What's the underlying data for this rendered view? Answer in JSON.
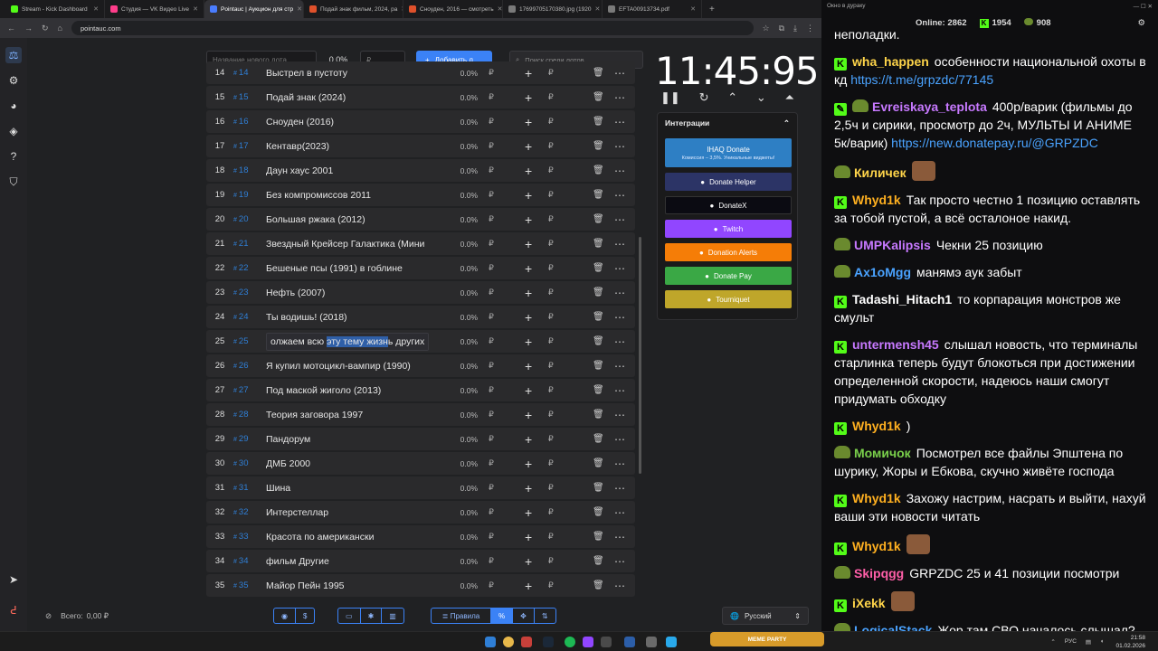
{
  "browser": {
    "tabs": [
      {
        "title": "Stream - Kick Dashboard",
        "color": "#53fc18"
      },
      {
        "title": "Студия — VK Видео Live",
        "color": "#ff3d8b"
      },
      {
        "title": "Pointauc | Аукцион для стр",
        "color": "#4a7dff"
      },
      {
        "title": "Подай знак фильм, 2024, ра",
        "color": "#e0512b"
      },
      {
        "title": "Сноуден, 2016 — смотреть",
        "color": "#e0512b"
      },
      {
        "title": "17699705170380.jpg (1920",
        "color": "#7a7a7a"
      },
      {
        "title": "EFTA00913734.pdf",
        "color": "#7a7a7a"
      }
    ],
    "url": "pointauc.com"
  },
  "toolbar": {
    "lot_placeholder": "Название нового лота",
    "percent": "0.0%",
    "price_placeholder": "₽",
    "add_label": "Добавить л",
    "search_placeholder": "Поиск среди лотов..."
  },
  "lots": [
    {
      "num": "14",
      "id": "14",
      "name": "Выстрел в пустоту",
      "pct": "0.0%"
    },
    {
      "num": "15",
      "id": "15",
      "name": "Подай знак (2024)",
      "pct": "0.0%"
    },
    {
      "num": "16",
      "id": "16",
      "name": "Сноуден (2016)",
      "pct": "0.0%"
    },
    {
      "num": "17",
      "id": "17",
      "name": "Кентавр(2023)",
      "pct": "0.0%"
    },
    {
      "num": "18",
      "id": "18",
      "name": "Даун хаус 2001",
      "pct": "0.0%"
    },
    {
      "num": "19",
      "id": "19",
      "name": "Без компромиссов 2011",
      "pct": "0.0%"
    },
    {
      "num": "20",
      "id": "20",
      "name": "Большая ржака (2012)",
      "pct": "0.0%"
    },
    {
      "num": "21",
      "id": "21",
      "name": "Звездный Крейсер Галактика (Мини",
      "pct": "0.0%"
    },
    {
      "num": "22",
      "id": "22",
      "name": "Бешеные псы (1991) в гоблине",
      "pct": "0.0%"
    },
    {
      "num": "23",
      "id": "23",
      "name": "Нефть (2007)",
      "pct": "0.0%"
    },
    {
      "num": "24",
      "id": "24",
      "name": "Ты водишь! (2018)",
      "pct": "0.0%"
    },
    {
      "num": "25",
      "id": "25",
      "name": "",
      "name_a": "олжаем всю ",
      "name_hl": "эту тему жизн",
      "name_b": "ь других",
      "pct": "0.0%"
    },
    {
      "num": "26",
      "id": "26",
      "name": "Я купил мотоцикл-вампир (1990)",
      "pct": "0.0%"
    },
    {
      "num": "27",
      "id": "27",
      "name": "Под маской жиголо (2013)",
      "pct": "0.0%"
    },
    {
      "num": "28",
      "id": "28",
      "name": "Теория заговора 1997",
      "pct": "0.0%"
    },
    {
      "num": "29",
      "id": "29",
      "name": "Пандорум",
      "pct": "0.0%"
    },
    {
      "num": "30",
      "id": "30",
      "name": "ДМБ 2000",
      "pct": "0.0%"
    },
    {
      "num": "31",
      "id": "31",
      "name": "Шина",
      "pct": "0.0%"
    },
    {
      "num": "32",
      "id": "32",
      "name": "Интерстеллар",
      "pct": "0.0%"
    },
    {
      "num": "33",
      "id": "33",
      "name": "Красота по американски",
      "pct": "0.0%"
    },
    {
      "num": "34",
      "id": "34",
      "name": "фильм Другие",
      "pct": "0.0%"
    },
    {
      "num": "35",
      "id": "35",
      "name": "Майор Пейн 1995",
      "pct": "0.0%"
    }
  ],
  "currency": "₽",
  "timer": "11:45:95",
  "integrations": {
    "title": "Интеграции",
    "ihaq": {
      "label": "IHAQ Donate",
      "sub": "Комиссия – 3,5%. Уникальные виджеты!"
    },
    "buttons": [
      {
        "label": "Donate Helper",
        "color": "#2c3466"
      },
      {
        "label": "DonateX",
        "color": "#0b0b12"
      },
      {
        "label": "Twitch",
        "color": "#9146ff"
      },
      {
        "label": "Donation Alerts",
        "color": "#f57d07"
      },
      {
        "label": "Donate Pay",
        "color": "#3aa845"
      },
      {
        "label": "Tourniquet",
        "color": "#bfa62a"
      }
    ]
  },
  "footer": {
    "total_label": "Всего:",
    "total_value": "0,00 ₽",
    "rules_label": "Правила",
    "language": "Русский"
  },
  "chat": {
    "window_title": "Окно в дураку",
    "online_label": "Online:",
    "online": "2862",
    "followers": "1954",
    "subs": "908",
    "messages": [
      {
        "user": "",
        "user_color": "#ffffff",
        "text": "неполадки.",
        "badge": "none"
      },
      {
        "user": "wha_happen",
        "user_color": "#ffd54a",
        "text": "особенности национальной охоты в кд ",
        "link": "https://t.me/grpzdc/77145",
        "badge": "kick"
      },
      {
        "user": "Evreiskaya_teplota",
        "user_color": "#c779ff",
        "text": "400р/варик (фильмы до 2,5ч и сирики, просмотр до 2ч, МУЛЬТЫ И АНИМЕ 5к/варик)",
        "link": "https://new.donatepay.ru/@GRPZDC",
        "badge": "edit"
      },
      {
        "user": "Киличек",
        "user_color": "#ffd54a",
        "text": "",
        "badge": "pepe"
      },
      {
        "user": "Whyd1k",
        "user_color": "#ffb020",
        "text": "Так просто честно 1 позицию оставлять за тобой пустой, а всё осталоное накид.",
        "badge": "kick"
      },
      {
        "user": "UMPKalipsis",
        "user_color": "#c779ff",
        "text": "Чекни 25 позицию",
        "badge": "pepe"
      },
      {
        "user": "Ax1oMgg",
        "user_color": "#4aa3ff",
        "text": "манямэ аук забыт",
        "badge": "pepe"
      },
      {
        "user": "Tadashi_Hitach1",
        "user_color": "#ffffff",
        "text": "то корпарация монстров же смульт",
        "badge": "kick"
      },
      {
        "user": "untermensh45",
        "user_color": "#c779ff",
        "text": "слышал новость, что терминалы старлинка теперь будут блокоться при достижении определенной скорости, надеюсь наши смогут придумать обходку",
        "badge": "kick"
      },
      {
        "user": "Whyd1k",
        "user_color": "#ffb020",
        "text": ")",
        "badge": "kick"
      },
      {
        "user": "Момичок",
        "user_color": "#7ad04b",
        "text": "Посмотрел все файлы Эпштена по шурику, Жоры и Ебкова, скучно живёте господа",
        "badge": "pepe"
      },
      {
        "user": "Whyd1k",
        "user_color": "#ffb020",
        "text": "Захожу настрим, насрать и выйти, нахуй ваши эти новости читать",
        "badge": "kick"
      },
      {
        "user": "Whyd1k",
        "user_color": "#ffb020",
        "text": "",
        "badge": "kick"
      },
      {
        "user": "Skipqgg",
        "user_color": "#ff5fa8",
        "text": "GRPZDC 25 и 41 позиции посмотри",
        "badge": "pepe"
      },
      {
        "user": "iXekk",
        "user_color": "#ffd54a",
        "text": "",
        "badge": "kick"
      },
      {
        "user": "LogicalStack",
        "user_color": "#4aa3ff",
        "text": "Жор там СВО началось слышал?",
        "badge": "pepe"
      }
    ]
  },
  "taskbar": {
    "lang": "РУС",
    "time": "21:58",
    "date": "01.02.2026",
    "widget": "MEME PARTY"
  }
}
